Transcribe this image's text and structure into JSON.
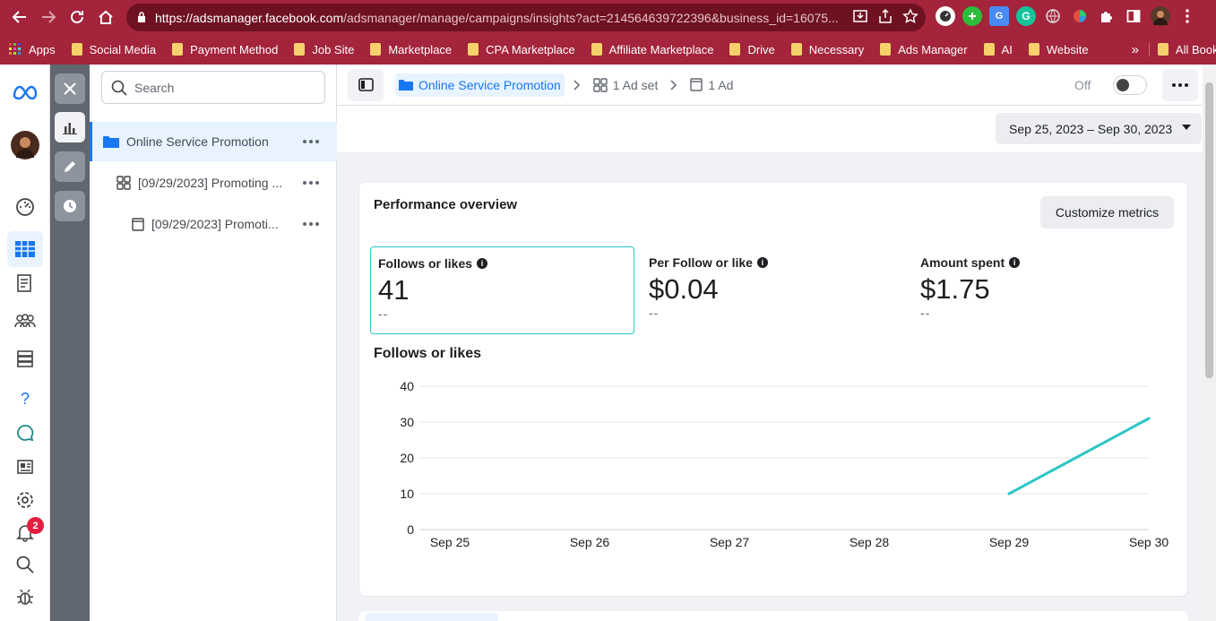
{
  "browser": {
    "url_host": "https://adsmanager.facebook.com",
    "url_path": "/adsmanager/manage/campaigns/insights?act=214564639722396&business_id=16075...",
    "bookmarks": [
      "Apps",
      "Social Media",
      "Payment Method",
      "Job Site",
      "Marketplace",
      "CPA Marketplace",
      "Affiliate Marketplace",
      "Drive",
      "Necessary",
      "Ads Manager",
      "AI",
      "Website"
    ],
    "more_bookmarks": "»",
    "all_bookmarks": "All Bookmarks"
  },
  "leftnav": {
    "notification_count": "2"
  },
  "tree": {
    "search_placeholder": "Search",
    "items": [
      {
        "label": "Online Service Promotion"
      },
      {
        "label": "[09/29/2023] Promoting ..."
      },
      {
        "label": "[09/29/2023] Promoti..."
      }
    ]
  },
  "topbar": {
    "campaign": "Online Service Promotion",
    "adset": "1 Ad set",
    "ad": "1 Ad",
    "toggle_label": "Off"
  },
  "date_range": "Sep 25, 2023 – Sep 30, 2023",
  "overview": {
    "title": "Performance overview",
    "customize_label": "Customize metrics",
    "metrics": [
      {
        "label": "Follows or likes",
        "value": "41",
        "compare": "--"
      },
      {
        "label": "Per Follow or like",
        "value": "$0.04",
        "compare": "--"
      },
      {
        "label": "Amount spent",
        "value": "$1.75",
        "compare": "--"
      }
    ],
    "chart_title": "Follows or likes"
  },
  "chart_data": {
    "type": "line",
    "categories": [
      "Sep 25",
      "Sep 26",
      "Sep 27",
      "Sep 28",
      "Sep 29",
      "Sep 30"
    ],
    "series": [
      {
        "values": [
          null,
          null,
          null,
          null,
          10,
          31
        ]
      }
    ],
    "yticks": [
      0,
      10,
      20,
      30,
      40
    ],
    "ylim": [
      0,
      40
    ],
    "grid": true,
    "color": "#2cc5c5"
  }
}
